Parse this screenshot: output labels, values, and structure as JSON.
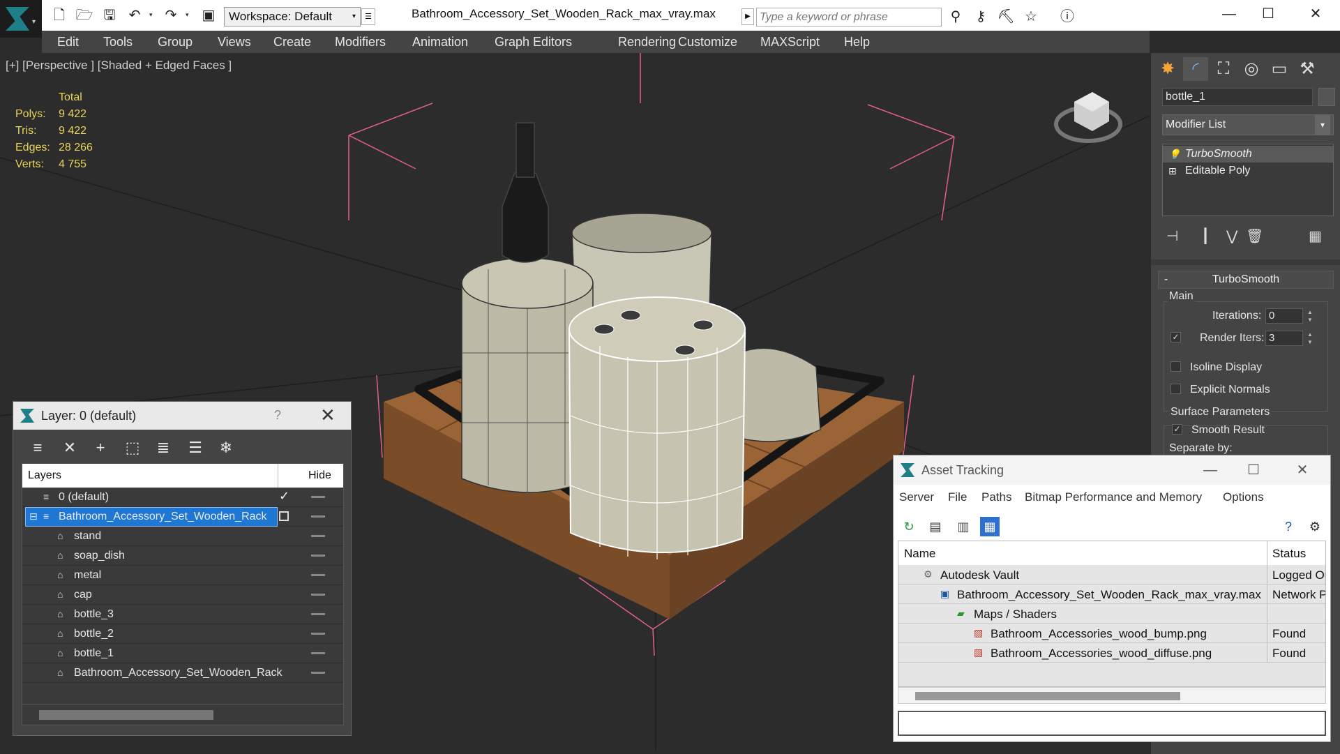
{
  "title_bar": {
    "workspace_label": "Workspace: Default",
    "document_title": "Bathroom_Accessory_Set_Wooden_Rack_max_vray.max",
    "search_placeholder": "Type a keyword or phrase"
  },
  "menu": [
    "Edit",
    "Tools",
    "Group",
    "Views",
    "Create",
    "Modifiers",
    "Animation",
    "Graph Editors",
    "Rendering",
    "Customize",
    "MAXScript",
    "Help"
  ],
  "viewport": {
    "label": "[+] [Perspective ] [Shaded + Edged Faces ]",
    "stats": {
      "header": "Total",
      "rows": [
        {
          "label": "Polys:",
          "value": "9 422"
        },
        {
          "label": "Tris:",
          "value": "9 422"
        },
        {
          "label": "Edges:",
          "value": "28 266"
        },
        {
          "label": "Verts:",
          "value": "4 755"
        }
      ]
    }
  },
  "command_panel": {
    "object_name": "bottle_1",
    "modifier_list_label": "Modifier List",
    "stack": [
      "TurboSmooth",
      "Editable Poly"
    ],
    "rollout_title": "TurboSmooth",
    "rollout_minus": "-",
    "main_group": "Main",
    "iterations_label": "Iterations:",
    "iterations_value": "0",
    "render_iters_label": "Render Iters:",
    "render_iters_value": "3",
    "isoline_label": "Isoline Display",
    "explicit_normals_label": "Explicit Normals",
    "surface_params_label": "Surface Parameters",
    "smooth_result_label": "Smooth Result",
    "separate_by_label": "Separate by:"
  },
  "layer_dialog": {
    "title": "Layer: 0 (default)",
    "help": "?",
    "col_layers": "Layers",
    "col_hide": "Hide",
    "rows": [
      {
        "name": "0 (default)",
        "level": 0,
        "active": true
      },
      {
        "name": "Bathroom_Accessory_Set_Wooden_Rack",
        "level": 0,
        "selected": true
      },
      {
        "name": "stand",
        "level": 1
      },
      {
        "name": "soap_dish",
        "level": 1
      },
      {
        "name": "metal",
        "level": 1
      },
      {
        "name": "cap",
        "level": 1
      },
      {
        "name": "bottle_3",
        "level": 1
      },
      {
        "name": "bottle_2",
        "level": 1
      },
      {
        "name": "bottle_1",
        "level": 1
      },
      {
        "name": "Bathroom_Accessory_Set_Wooden_Rack",
        "level": 1
      }
    ]
  },
  "asset_dialog": {
    "title": "Asset Tracking",
    "menu": [
      "Server",
      "File",
      "Paths",
      "Bitmap Performance and Memory",
      "Options"
    ],
    "col_name": "Name",
    "col_status": "Status",
    "rows": [
      {
        "name": "Autodesk Vault",
        "status": "Logged Ou",
        "level": 0
      },
      {
        "name": "Bathroom_Accessory_Set_Wooden_Rack_max_vray.max",
        "status": "Network Pa",
        "level": 1
      },
      {
        "name": "Maps / Shaders",
        "status": "",
        "level": 2
      },
      {
        "name": "Bathroom_Accessories_wood_bump.png",
        "status": "Found",
        "level": 3
      },
      {
        "name": "Bathroom_Accessories_wood_diffuse.png",
        "status": "Found",
        "level": 3
      }
    ]
  }
}
